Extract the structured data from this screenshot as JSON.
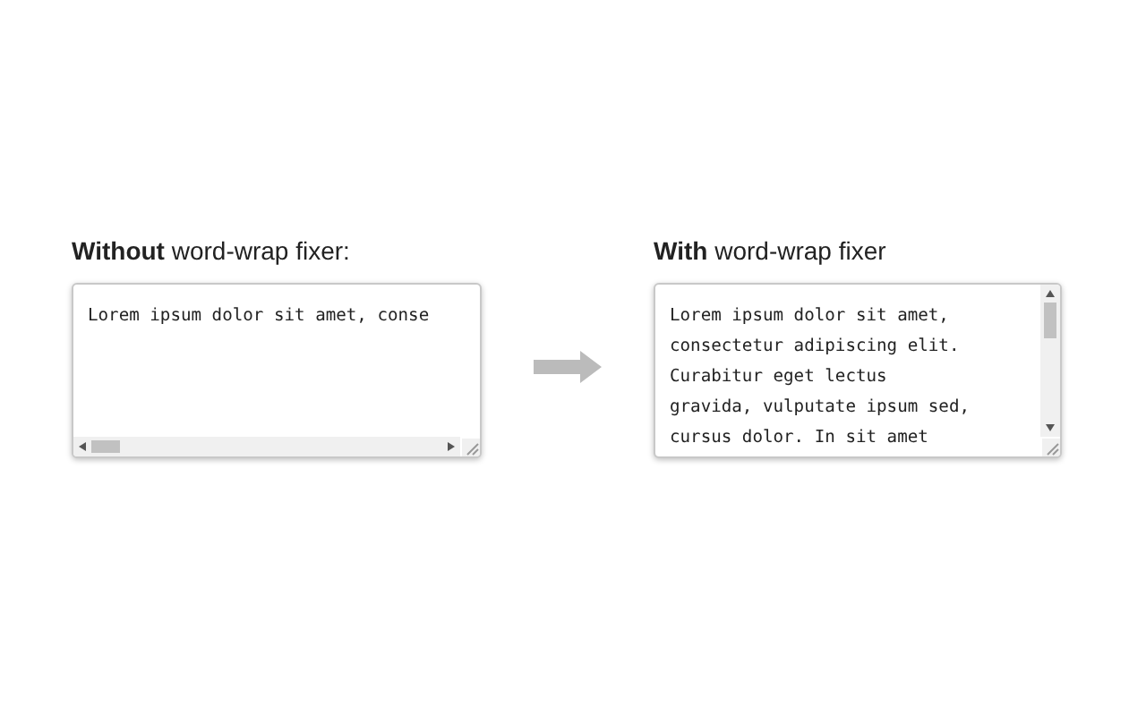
{
  "panels": [
    {
      "title": "**Without** word-wrap fixer:",
      "kind": "hscroll",
      "lines": [
        "Lorem ipsum dolor sit amet, conse"
      ]
    },
    {
      "title": "**With** word-wrap fixer",
      "kind": "vscroll",
      "lines": [
        "Lorem ipsum dolor sit amet,",
        "consectetur adipiscing elit.",
        "Curabitur eget lectus",
        "gravida, vulputate ipsum sed,",
        "cursus dolor. In sit amet"
      ]
    }
  ]
}
